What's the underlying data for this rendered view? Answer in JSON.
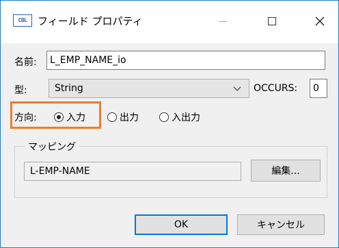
{
  "window": {
    "icon_text": "CBL",
    "title": "フィールド プロパティ"
  },
  "titlebar_buttons": {
    "minimize": "minimize-icon",
    "maximize": "maximize-icon",
    "close": "close-icon"
  },
  "form": {
    "name_label": "名前:",
    "name_value": "L_EMP_NAME_io",
    "type_label": "型:",
    "type_value": "String",
    "occurs_label": "OCCURS:",
    "occurs_value": "0",
    "direction_label": "方向:",
    "direction_options": [
      {
        "label": "入力",
        "selected": true
      },
      {
        "label": "出力",
        "selected": false
      },
      {
        "label": "入出力",
        "selected": false
      }
    ]
  },
  "mapping": {
    "group_label": "マッピング",
    "value": "L-EMP-NAME",
    "edit_button": "編集..."
  },
  "footer": {
    "ok_label": "OK",
    "cancel_label": "キャンセル"
  },
  "colors": {
    "highlight": "#ef7d2b",
    "window_border": "#1e7bd8",
    "icon": "#1f63c6"
  }
}
